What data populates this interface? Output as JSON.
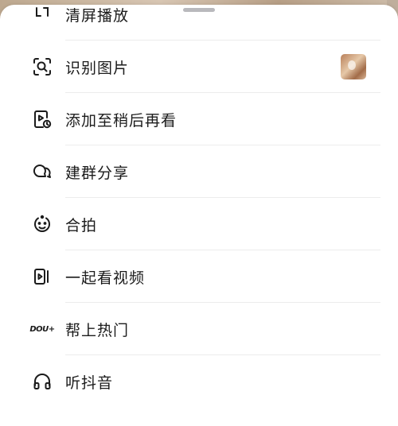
{
  "sheet": {
    "items": [
      {
        "label": "清屏播放",
        "icon": "clear-screen-icon"
      },
      {
        "label": "识别图片",
        "icon": "image-recognition-icon"
      },
      {
        "label": "添加至稍后再看",
        "icon": "watch-later-icon"
      },
      {
        "label": "建群分享",
        "icon": "group-chat-icon"
      },
      {
        "label": "合拍",
        "icon": "duet-icon"
      },
      {
        "label": "一起看视频",
        "icon": "watch-together-icon"
      },
      {
        "label": "帮上热门",
        "icon": "dou-plus-icon",
        "icon_text": "DOU+"
      },
      {
        "label": "听抖音",
        "icon": "headphones-icon"
      }
    ]
  }
}
